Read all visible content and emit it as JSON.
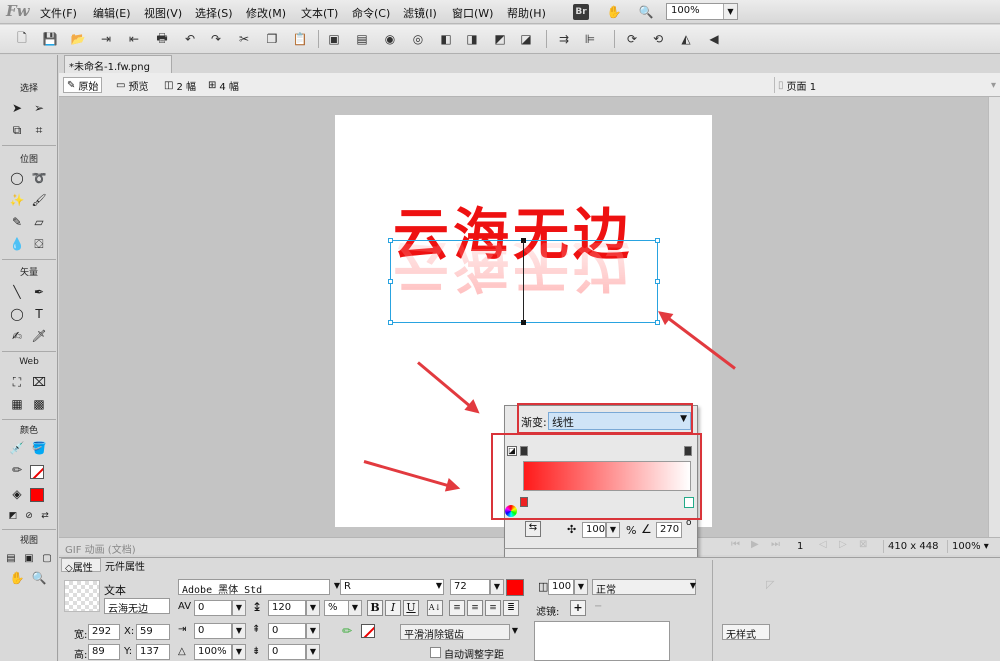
{
  "app": {
    "logo": "Fw",
    "menus": [
      "文件(F)",
      "编辑(E)",
      "视图(V)",
      "选择(S)",
      "修改(M)",
      "文本(T)",
      "命令(C)",
      "滤镜(I)",
      "窗口(W)",
      "帮助(H)"
    ],
    "bridge": "Br",
    "zoom": "100%"
  },
  "document": {
    "tab_title": "*未命名-1.fw.png",
    "canvas_text": "云海无边",
    "page_label": "页面 1"
  },
  "view_modes": {
    "original": "原始",
    "preview": "预览",
    "two_up": "2 幅",
    "four_up": "4 幅"
  },
  "tools": {
    "select": "选择",
    "bitmap": "位图",
    "vector": "矢量",
    "web": "Web",
    "colors": "颜色",
    "view": "视图"
  },
  "status": {
    "left": "GIF 动画 (文档)",
    "frame": "1",
    "size": "410 x 448",
    "zoom": "100%"
  },
  "gradient_popup": {
    "label": "渐变:",
    "type": "线性",
    "opacity": "100",
    "percent": "%",
    "angle": "270",
    "degree": "o",
    "colors": {
      "start": "#ff1a1a",
      "end": "#ffffff"
    }
  },
  "properties": {
    "tabs": [
      "属性",
      "元件属性"
    ],
    "object_type": "文本",
    "object_name": "云海无边",
    "font": "Adobe 黑体 Std",
    "style": "R",
    "size": "72",
    "color": "#ff0000",
    "kerning": "0",
    "leading": "120",
    "leading_unit": "%",
    "bold": "B",
    "italic": "I",
    "underline": "U",
    "indent": "0",
    "space_before": "0",
    "scale": "100%",
    "space_after": "0",
    "width_label": "宽:",
    "width": "292",
    "x_label": "X:",
    "x": "59",
    "height_label": "高:",
    "height": "89",
    "y_label": "Y:",
    "y": "137",
    "antialias": "平滑消除锯齿",
    "auto_kern": "自动调整字距",
    "opacity": "100",
    "blend": "正常",
    "filters_label": "滤镜:",
    "no_style": "无样式"
  }
}
